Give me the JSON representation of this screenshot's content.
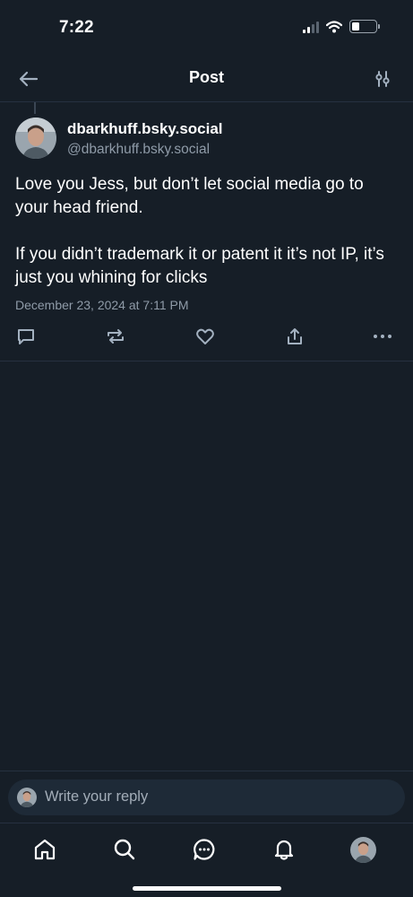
{
  "status_bar": {
    "time": "7:22",
    "battery_level": 0.25
  },
  "header": {
    "title": "Post",
    "back_icon": "arrow-left-icon",
    "filter_icon": "sliders-icon"
  },
  "post": {
    "display_name": "dbarkhuff.bsky.social",
    "handle": "@dbarkhuff.bsky.social",
    "text": "Love you Jess, but don’t let social media go to your head friend.\n\nIf you didn’t trademark it or patent it it’s not IP, it’s just you whining for clicks",
    "timestamp": "December 23, 2024 at 7:11 PM",
    "actions": [
      "reply-icon",
      "repost-icon",
      "like-icon",
      "share-icon",
      "more-icon"
    ]
  },
  "reply": {
    "placeholder": "Write your reply"
  },
  "tab_bar": {
    "tabs": [
      "home-icon",
      "search-icon",
      "chat-icon",
      "bell-icon",
      "profile-avatar"
    ]
  },
  "colors": {
    "background": "#161e27",
    "text": "#ffffff",
    "muted": "#8f9ba8",
    "icon": "#a3b1c0",
    "divider": "#263140",
    "reply_box": "#1e2a37"
  }
}
